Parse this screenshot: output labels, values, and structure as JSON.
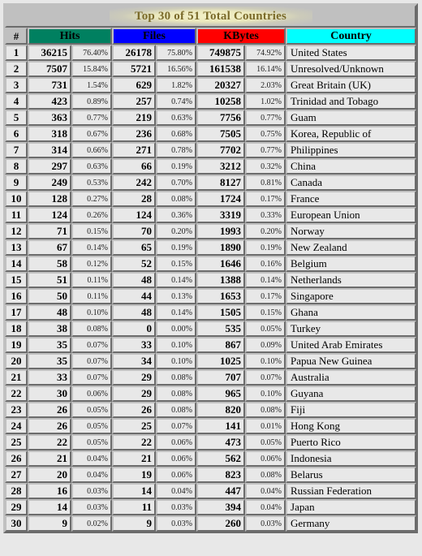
{
  "report": {
    "title": "Top 30 of 51 Total Countries",
    "columns": {
      "num": "#",
      "hits": "Hits",
      "files": "Files",
      "kbytes": "KBytes",
      "country": "Country"
    },
    "colors": {
      "hits_header": "#008060",
      "files_header": "#0000ff",
      "kbytes_header": "#ff0000",
      "country_header": "#00ffff",
      "title_text": "#7a6a2a",
      "title_band": "#c0c0c0",
      "cell_background": "#e8e8e8"
    }
  },
  "chart_data": {
    "type": "table",
    "title": "Top 30 of 51 Total Countries",
    "columns": [
      "#",
      "Hits",
      "Hits %",
      "Files",
      "Files %",
      "KBytes",
      "KBytes %",
      "Country"
    ],
    "rows": [
      {
        "num": "1",
        "hits": "36215",
        "hits_pct": "76.40%",
        "files": "26178",
        "files_pct": "75.80%",
        "kbytes": "749875",
        "kbytes_pct": "74.92%",
        "country": "United States"
      },
      {
        "num": "2",
        "hits": "7507",
        "hits_pct": "15.84%",
        "files": "5721",
        "files_pct": "16.56%",
        "kbytes": "161538",
        "kbytes_pct": "16.14%",
        "country": "Unresolved/Unknown"
      },
      {
        "num": "3",
        "hits": "731",
        "hits_pct": "1.54%",
        "files": "629",
        "files_pct": "1.82%",
        "kbytes": "20327",
        "kbytes_pct": "2.03%",
        "country": "Great Britain (UK)"
      },
      {
        "num": "4",
        "hits": "423",
        "hits_pct": "0.89%",
        "files": "257",
        "files_pct": "0.74%",
        "kbytes": "10258",
        "kbytes_pct": "1.02%",
        "country": "Trinidad and Tobago"
      },
      {
        "num": "5",
        "hits": "363",
        "hits_pct": "0.77%",
        "files": "219",
        "files_pct": "0.63%",
        "kbytes": "7756",
        "kbytes_pct": "0.77%",
        "country": "Guam"
      },
      {
        "num": "6",
        "hits": "318",
        "hits_pct": "0.67%",
        "files": "236",
        "files_pct": "0.68%",
        "kbytes": "7505",
        "kbytes_pct": "0.75%",
        "country": "Korea, Republic of"
      },
      {
        "num": "7",
        "hits": "314",
        "hits_pct": "0.66%",
        "files": "271",
        "files_pct": "0.78%",
        "kbytes": "7702",
        "kbytes_pct": "0.77%",
        "country": "Philippines"
      },
      {
        "num": "8",
        "hits": "297",
        "hits_pct": "0.63%",
        "files": "66",
        "files_pct": "0.19%",
        "kbytes": "3212",
        "kbytes_pct": "0.32%",
        "country": "China"
      },
      {
        "num": "9",
        "hits": "249",
        "hits_pct": "0.53%",
        "files": "242",
        "files_pct": "0.70%",
        "kbytes": "8127",
        "kbytes_pct": "0.81%",
        "country": "Canada"
      },
      {
        "num": "10",
        "hits": "128",
        "hits_pct": "0.27%",
        "files": "28",
        "files_pct": "0.08%",
        "kbytes": "1724",
        "kbytes_pct": "0.17%",
        "country": "France"
      },
      {
        "num": "11",
        "hits": "124",
        "hits_pct": "0.26%",
        "files": "124",
        "files_pct": "0.36%",
        "kbytes": "3319",
        "kbytes_pct": "0.33%",
        "country": "European Union"
      },
      {
        "num": "12",
        "hits": "71",
        "hits_pct": "0.15%",
        "files": "70",
        "files_pct": "0.20%",
        "kbytes": "1993",
        "kbytes_pct": "0.20%",
        "country": "Norway"
      },
      {
        "num": "13",
        "hits": "67",
        "hits_pct": "0.14%",
        "files": "65",
        "files_pct": "0.19%",
        "kbytes": "1890",
        "kbytes_pct": "0.19%",
        "country": "New Zealand"
      },
      {
        "num": "14",
        "hits": "58",
        "hits_pct": "0.12%",
        "files": "52",
        "files_pct": "0.15%",
        "kbytes": "1646",
        "kbytes_pct": "0.16%",
        "country": "Belgium"
      },
      {
        "num": "15",
        "hits": "51",
        "hits_pct": "0.11%",
        "files": "48",
        "files_pct": "0.14%",
        "kbytes": "1388",
        "kbytes_pct": "0.14%",
        "country": "Netherlands"
      },
      {
        "num": "16",
        "hits": "50",
        "hits_pct": "0.11%",
        "files": "44",
        "files_pct": "0.13%",
        "kbytes": "1653",
        "kbytes_pct": "0.17%",
        "country": "Singapore"
      },
      {
        "num": "17",
        "hits": "48",
        "hits_pct": "0.10%",
        "files": "48",
        "files_pct": "0.14%",
        "kbytes": "1505",
        "kbytes_pct": "0.15%",
        "country": "Ghana"
      },
      {
        "num": "18",
        "hits": "38",
        "hits_pct": "0.08%",
        "files": "0",
        "files_pct": "0.00%",
        "kbytes": "535",
        "kbytes_pct": "0.05%",
        "country": "Turkey"
      },
      {
        "num": "19",
        "hits": "35",
        "hits_pct": "0.07%",
        "files": "33",
        "files_pct": "0.10%",
        "kbytes": "867",
        "kbytes_pct": "0.09%",
        "country": "United Arab Emirates"
      },
      {
        "num": "20",
        "hits": "35",
        "hits_pct": "0.07%",
        "files": "34",
        "files_pct": "0.10%",
        "kbytes": "1025",
        "kbytes_pct": "0.10%",
        "country": "Papua New Guinea"
      },
      {
        "num": "21",
        "hits": "33",
        "hits_pct": "0.07%",
        "files": "29",
        "files_pct": "0.08%",
        "kbytes": "707",
        "kbytes_pct": "0.07%",
        "country": "Australia"
      },
      {
        "num": "22",
        "hits": "30",
        "hits_pct": "0.06%",
        "files": "29",
        "files_pct": "0.08%",
        "kbytes": "965",
        "kbytes_pct": "0.10%",
        "country": "Guyana"
      },
      {
        "num": "23",
        "hits": "26",
        "hits_pct": "0.05%",
        "files": "26",
        "files_pct": "0.08%",
        "kbytes": "820",
        "kbytes_pct": "0.08%",
        "country": "Fiji"
      },
      {
        "num": "24",
        "hits": "26",
        "hits_pct": "0.05%",
        "files": "25",
        "files_pct": "0.07%",
        "kbytes": "141",
        "kbytes_pct": "0.01%",
        "country": "Hong Kong"
      },
      {
        "num": "25",
        "hits": "22",
        "hits_pct": "0.05%",
        "files": "22",
        "files_pct": "0.06%",
        "kbytes": "473",
        "kbytes_pct": "0.05%",
        "country": "Puerto Rico"
      },
      {
        "num": "26",
        "hits": "21",
        "hits_pct": "0.04%",
        "files": "21",
        "files_pct": "0.06%",
        "kbytes": "562",
        "kbytes_pct": "0.06%",
        "country": "Indonesia"
      },
      {
        "num": "27",
        "hits": "20",
        "hits_pct": "0.04%",
        "files": "19",
        "files_pct": "0.06%",
        "kbytes": "823",
        "kbytes_pct": "0.08%",
        "country": "Belarus"
      },
      {
        "num": "28",
        "hits": "16",
        "hits_pct": "0.03%",
        "files": "14",
        "files_pct": "0.04%",
        "kbytes": "447",
        "kbytes_pct": "0.04%",
        "country": "Russian Federation"
      },
      {
        "num": "29",
        "hits": "14",
        "hits_pct": "0.03%",
        "files": "11",
        "files_pct": "0.03%",
        "kbytes": "394",
        "kbytes_pct": "0.04%",
        "country": "Japan"
      },
      {
        "num": "30",
        "hits": "9",
        "hits_pct": "0.02%",
        "files": "9",
        "files_pct": "0.03%",
        "kbytes": "260",
        "kbytes_pct": "0.03%",
        "country": "Germany"
      }
    ]
  }
}
